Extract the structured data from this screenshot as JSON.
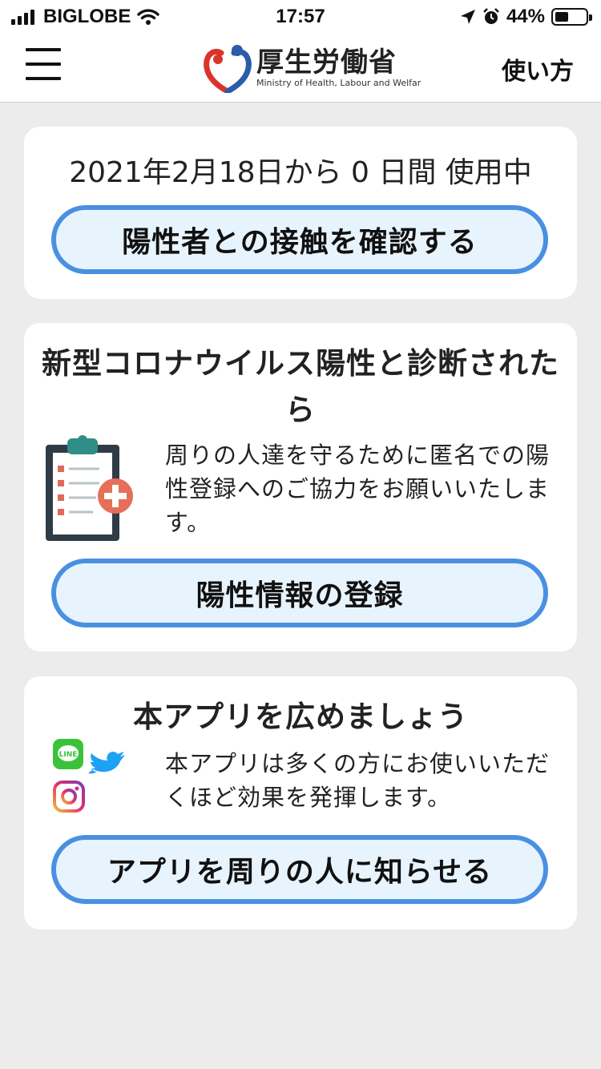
{
  "status_bar": {
    "carrier": "BIGLOBE",
    "time": "17:57",
    "battery": "44%",
    "battery_level": 0.44
  },
  "header": {
    "logo_ja": "厚生労働省",
    "logo_en": "Ministry of Health, Labour and Welfar",
    "help_label": "使い方"
  },
  "usage": {
    "text": "2021年2月18日から 0 日間 使用中",
    "check_button": "陽性者との接触を確認する"
  },
  "positive": {
    "title": "新型コロナウイルス陽性と診断されたら",
    "body": "周りの人達を守るために匿名での陽性登録へのご協力をお願いいたします。",
    "register_button": "陽性情報の登録"
  },
  "share": {
    "title": "本アプリを広めましょう",
    "body": "本アプリは多くの方にお使いいただくほど効果を発揮します。",
    "share_button": "アプリを周りの人に知らせる",
    "icons": [
      "line-icon",
      "twitter-icon",
      "instagram-icon"
    ]
  },
  "colors": {
    "button_border": "#4a90e2",
    "button_fill": "#e8f4fd",
    "background": "#ececec",
    "logo_blue": "#2a5ca8",
    "logo_red": "#d9342b"
  }
}
